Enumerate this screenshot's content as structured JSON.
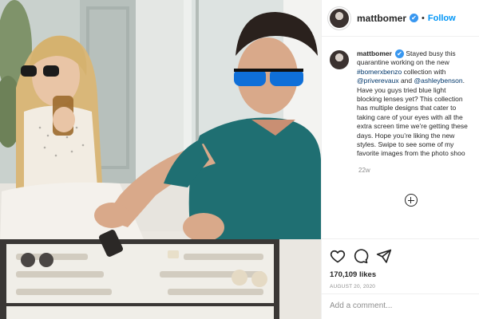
{
  "header": {
    "username": "mattbomer",
    "verified_glyph": "✔",
    "separator": "•",
    "follow_label": "Follow"
  },
  "caption": {
    "username": "mattbomer",
    "line1_tail": "Stayed busy this",
    "line2": "quarantine working on the new",
    "line3_link": "#bomerxbenzo",
    "line3_tail": " collection with",
    "line4_link1": "@priverevaux",
    "line4_mid": " and ",
    "line4_link2": "@ashleybenson",
    "line4_end": ".",
    "line5": "Have you guys tried blue light",
    "line6": "blocking lenses yet? This collection",
    "line7": "has multiple designs that cater to",
    "line8": "taking care of your eyes with all the",
    "line9": "extra screen time we’re getting these",
    "line10": "days. Hope you’re liking the new",
    "line11": "styles. Swipe to see some of my",
    "line12": "favorite images from the photo shoo"
  },
  "post": {
    "time_ago": "22w",
    "likes": "170,109 likes",
    "date": "AUGUST 20, 2020",
    "comment_placeholder": "Add a comment..."
  },
  "icons": {
    "avatar": "profile-photo",
    "verified": "verified-badge-icon",
    "load_more": "plus-circle-icon",
    "like": "heart-icon",
    "comment": "comment-icon",
    "share": "paper-plane-icon"
  },
  "colors": {
    "accent": "#0095f6",
    "verified": "#3897f0",
    "muted": "#8e8e8e",
    "text": "#262626",
    "link": "#00376b"
  }
}
